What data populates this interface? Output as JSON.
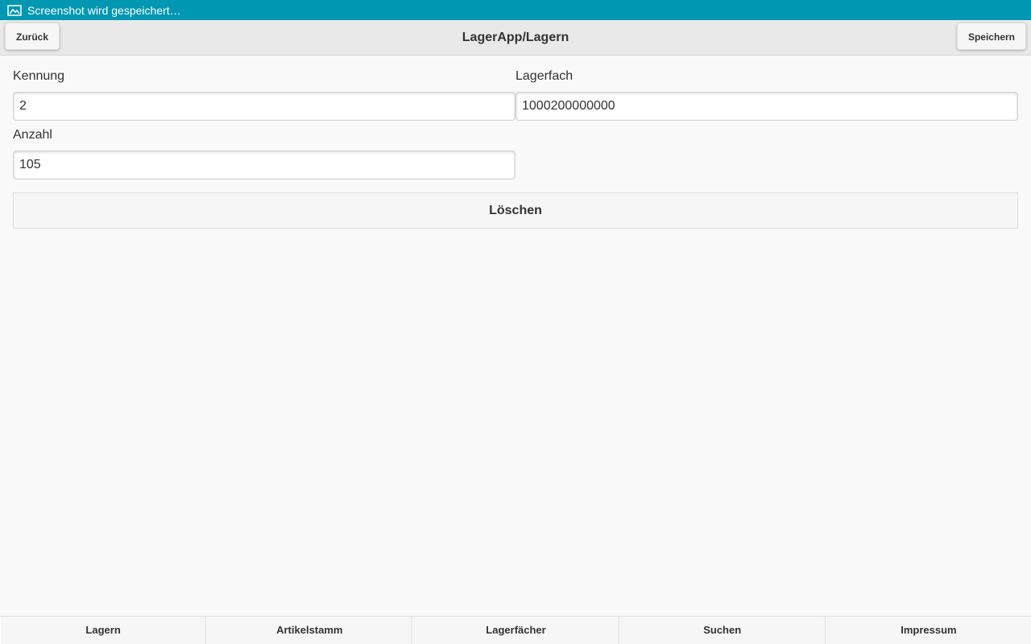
{
  "status_bar": {
    "icon": "image-icon",
    "text": "Screenshot wird gespeichert…",
    "color": "#0097b2"
  },
  "header": {
    "title": "LagerApp/Lagern",
    "back_label": "Zurück",
    "save_label": "Speichern"
  },
  "form": {
    "kennung": {
      "label": "Kennung",
      "value": "2"
    },
    "lagerfach": {
      "label": "Lagerfach",
      "value": "1000200000000"
    },
    "anzahl": {
      "label": "Anzahl",
      "value": "105"
    },
    "delete_label": "Löschen"
  },
  "navbar": {
    "items": [
      {
        "label": "Lagern"
      },
      {
        "label": "Artikelstamm"
      },
      {
        "label": "Lagerfächer"
      },
      {
        "label": "Suchen"
      },
      {
        "label": "Impressum"
      }
    ]
  }
}
